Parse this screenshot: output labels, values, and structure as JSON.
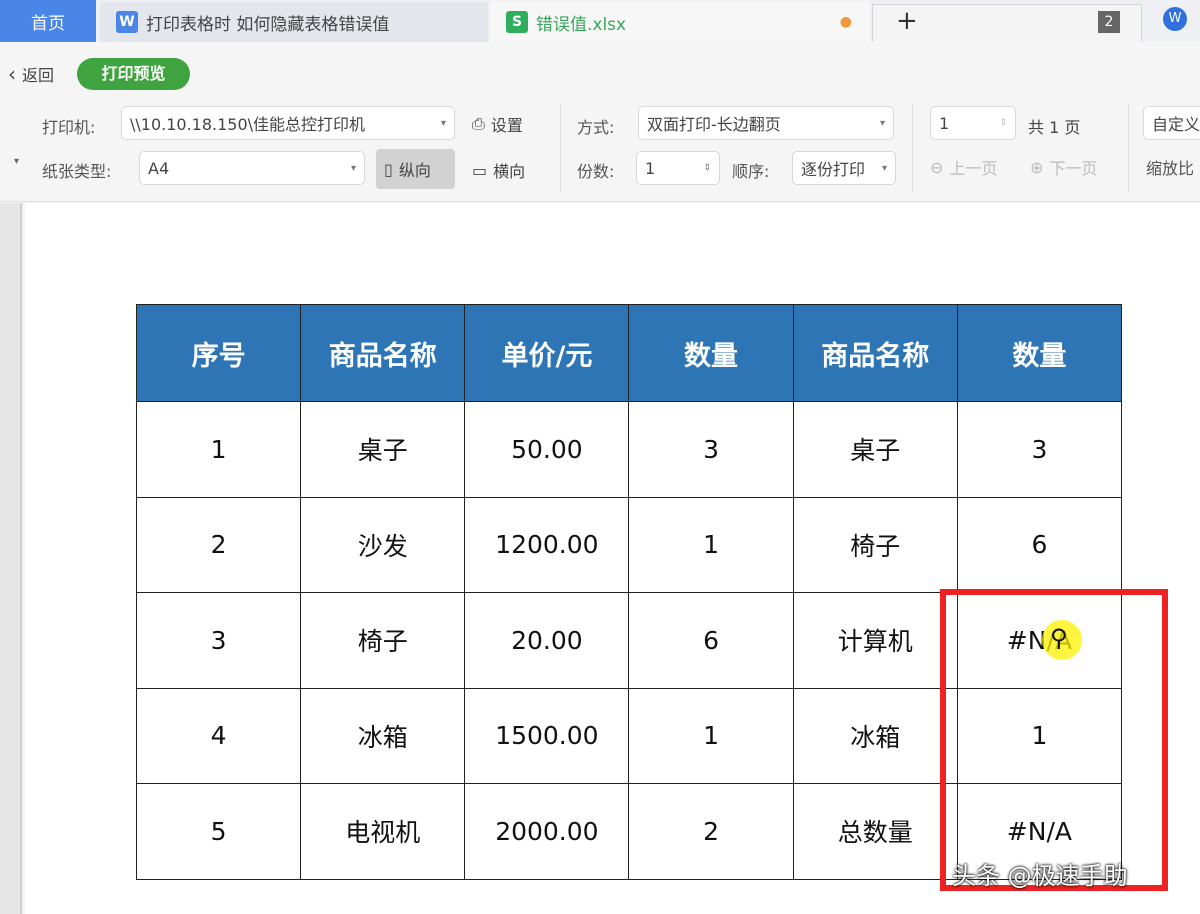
{
  "tabs": {
    "home": "首页",
    "doc": "打印表格时 如何隐藏表格错误值",
    "sheet": "错误值.xlsx",
    "new_tab": "+",
    "window_count": "2"
  },
  "toolbar": {
    "back": "返回",
    "mode": "打印预览",
    "printer_label": "打印机:",
    "printer": "\\\\10.10.18.150\\佳能总控打印机",
    "settings": "设置",
    "paper_label": "纸张类型:",
    "paper": "A4",
    "portrait": "纵向",
    "landscape": "横向",
    "method_label": "方式:",
    "method": "双面打印-长边翻页",
    "copies_label": "份数:",
    "copies": "1",
    "order_label": "顺序:",
    "order": "逐份打印",
    "page_num": "1",
    "page_total": "共 1 页",
    "prev_page": "上一页",
    "next_page": "下一页",
    "zoom_mode": "自定义",
    "zoom_label": "缩放比"
  },
  "table": {
    "headers": [
      "序号",
      "商品名称",
      "单价/元",
      "数量",
      "商品名称",
      "数量"
    ],
    "rows": [
      [
        "1",
        "桌子",
        "50.00",
        "3",
        "桌子",
        "3"
      ],
      [
        "2",
        "沙发",
        "1200.00",
        "1",
        "椅子",
        "6"
      ],
      [
        "3",
        "椅子",
        "20.00",
        "6",
        "计算机",
        "#N/A"
      ],
      [
        "4",
        "冰箱",
        "1500.00",
        "1",
        "冰箱",
        "1"
      ],
      [
        "5",
        "电视机",
        "2000.00",
        "2",
        "总数量",
        "#N/A"
      ]
    ]
  },
  "watermark": "头条 @极速手助",
  "colors": {
    "header": "#2e75b6",
    "highlight": "#ee2222",
    "accent": "#4a86e8"
  }
}
